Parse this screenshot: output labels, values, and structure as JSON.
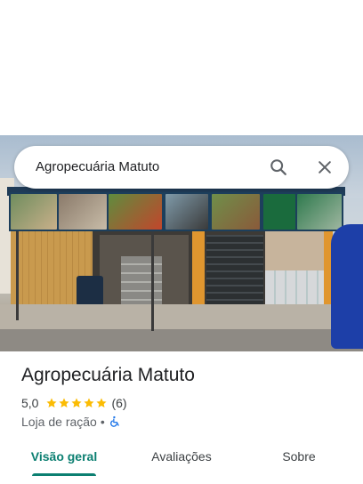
{
  "search": {
    "query": "Agropecuária Matuto"
  },
  "place": {
    "title": "Agropecuária Matuto",
    "rating": "5,0",
    "stars": 5,
    "review_count": "(6)",
    "category": "Loja de ração",
    "separator": "•",
    "accessibility_icon": "wheelchair-icon"
  },
  "tabs": [
    {
      "label": "Visão geral",
      "active": true
    },
    {
      "label": "Avaliações",
      "active": false
    },
    {
      "label": "Sobre",
      "active": false
    }
  ],
  "colors": {
    "accent": "#0b7f71",
    "star": "#fbbc04",
    "accessibility": "#1a73e8"
  }
}
